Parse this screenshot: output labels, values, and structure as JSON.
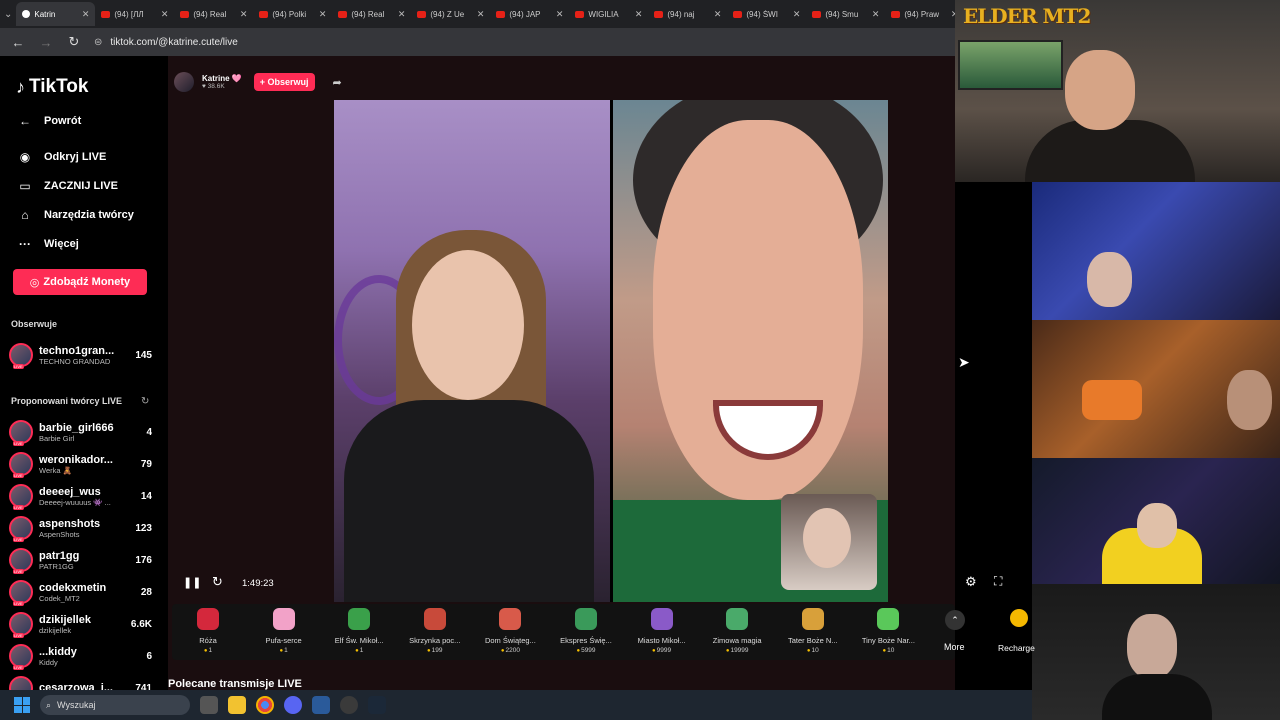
{
  "browser": {
    "tabs": [
      {
        "label": "Katrin",
        "active": true
      },
      {
        "label": "(94) [ЛЛ"
      },
      {
        "label": "(94) Real"
      },
      {
        "label": "(94) Polki"
      },
      {
        "label": "(94) Real"
      },
      {
        "label": "(94) Z Ue"
      },
      {
        "label": "(94) JAP"
      },
      {
        "label": "WIGILIA"
      },
      {
        "label": "(94) naj"
      },
      {
        "label": "(94) ŚWI"
      },
      {
        "label": "(94) Smu"
      },
      {
        "label": "(94) Praw"
      }
    ],
    "url": "tiktok.com/@katrine.cute/live"
  },
  "sidebar": {
    "logo": "TikTok",
    "back": "Powrót",
    "nav": [
      {
        "label": "Odkryj LIVE",
        "icon": "live-discover-icon"
      },
      {
        "label": "ZACZNIJ LIVE",
        "icon": "camera-icon"
      },
      {
        "label": "Narzędzia twórcy",
        "icon": "home-icon"
      },
      {
        "label": "Więcej",
        "icon": "more-dots-icon"
      }
    ],
    "coins_button": "Zdobądź Monety",
    "following_title": "Obserwuje",
    "following": [
      {
        "name": "techno1gran...",
        "sub": "TECHNO GRANDAD",
        "count": "145"
      }
    ],
    "suggested_title": "Proponowani twórcy LIVE",
    "suggested": [
      {
        "name": "barbie_girl666",
        "sub": "Barbie Girl",
        "count": "4"
      },
      {
        "name": "weronikador...",
        "sub": "Werka 🧸",
        "count": "79"
      },
      {
        "name": "deeeej_wus",
        "sub": "Deeeej-wuuuus 👾 ...",
        "count": "14"
      },
      {
        "name": "aspenshots",
        "sub": "AspenShots",
        "count": "123"
      },
      {
        "name": "patr1gg",
        "sub": "PATR1GG",
        "count": "176"
      },
      {
        "name": "codekxmetin",
        "sub": "Codek_MT2",
        "count": "28"
      },
      {
        "name": "dzikijellek",
        "sub": "dzikijellek",
        "count": "6.6K"
      },
      {
        "name": "...kiddy",
        "sub": "Kiddy",
        "count": "6"
      },
      {
        "name": "cesarzowa_i...",
        "sub": "",
        "count": "741"
      }
    ]
  },
  "live": {
    "host_name": "Katrine 🩷",
    "host_likes": "♥ 38.6K",
    "follow_label": "+ Obserwuj",
    "time": "1:49:23",
    "gifts": [
      {
        "name": "Róża",
        "price": "1",
        "color": "#d4283c"
      },
      {
        "name": "Pufa-serce",
        "price": "1",
        "color": "#f2a2c8"
      },
      {
        "name": "Elf Św. Mikoł...",
        "price": "1",
        "color": "#3aa04a"
      },
      {
        "name": "Skrzynka poc...",
        "price": "199",
        "color": "#c84a3a"
      },
      {
        "name": "Dom Świąteg...",
        "price": "2200",
        "color": "#d85a4a"
      },
      {
        "name": "Ekspres Świę...",
        "price": "5999",
        "color": "#3a9a5a"
      },
      {
        "name": "Miasto Mikoł...",
        "price": "9999",
        "color": "#8a5ac8"
      },
      {
        "name": "Zimowa magia",
        "price": "19999",
        "color": "#4aaa6a"
      },
      {
        "name": "Tater Boże N...",
        "price": "10",
        "color": "#d8a03a"
      },
      {
        "name": "Tiny Boże Nar...",
        "price": "10",
        "color": "#5ac85a"
      }
    ],
    "more_label": "More",
    "recharge_label": "Recharge",
    "recommended_title": "Polecane transmisje LIVE"
  },
  "taskbar": {
    "search_placeholder": "Wyszukaj"
  },
  "overlay": {
    "brand": "ELDER MT2"
  }
}
